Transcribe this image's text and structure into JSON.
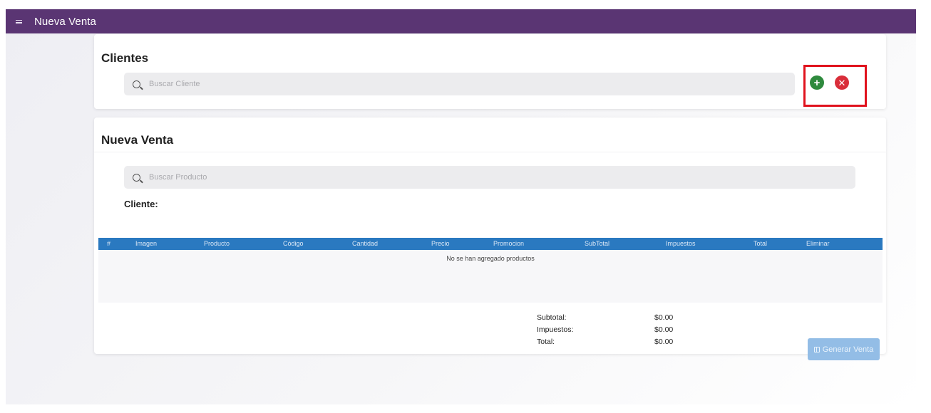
{
  "topbar": {
    "title": "Nueva Venta",
    "menu_icon": "hamburger-icon"
  },
  "clientes": {
    "title": "Clientes",
    "search_placeholder": "Buscar Cliente",
    "add_icon": "plus-circle-icon",
    "cancel_icon": "x-circle-icon"
  },
  "venta": {
    "title": "Nueva Venta",
    "search_placeholder": "Buscar Producto",
    "cliente_label": "Cliente:",
    "table": {
      "headers": [
        "#",
        "Imagen",
        "Producto",
        "Código",
        "Cantidad",
        "Precio",
        "Promocion",
        "SubTotal",
        "Impuestos",
        "Total",
        "Eliminar"
      ],
      "empty_message": "No se han agregado productos"
    },
    "totals": {
      "subtotal_label": "Subtotal:",
      "subtotal_value": "$0.00",
      "impuestos_label": "Impuestos:",
      "impuestos_value": "$0.00",
      "total_label": "Total:",
      "total_value": "$0.00"
    },
    "generate_button": "Generar Venta"
  },
  "colors": {
    "topbar": "#5a3573",
    "table_header": "#2a79c0",
    "add_button": "#2e8a3d",
    "cancel_button": "#d92e3a",
    "highlight_box": "#e0121d",
    "generate_button": "#93bde6"
  }
}
